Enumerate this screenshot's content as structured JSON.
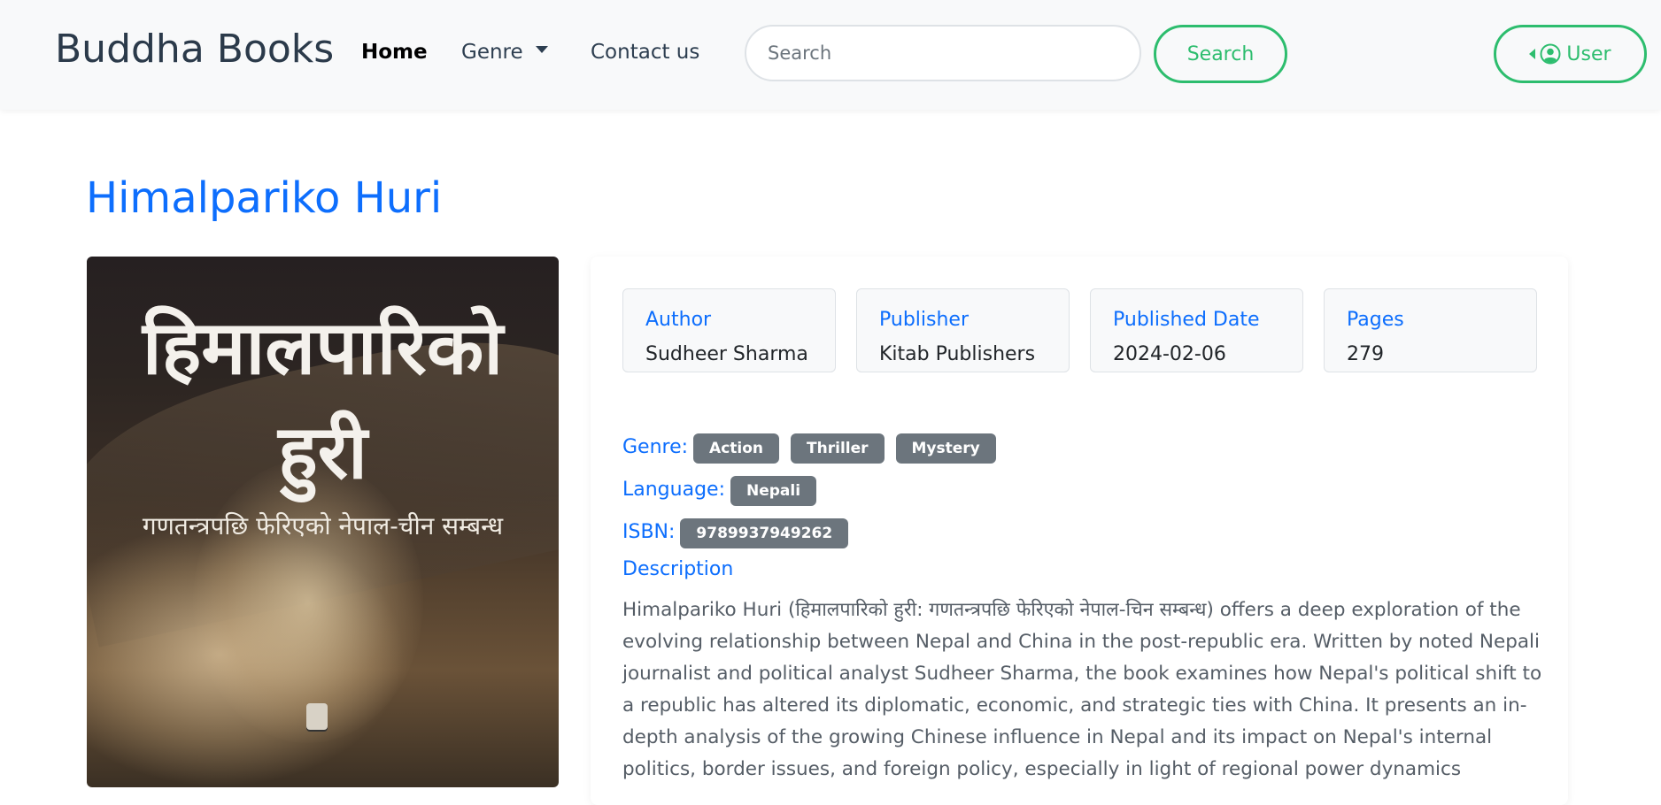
{
  "navbar": {
    "brand": "Buddha Books",
    "links": {
      "home": "Home",
      "genre": "Genre",
      "contact": "Contact us"
    },
    "search": {
      "placeholder": "Search",
      "value": "",
      "button_label": "Search"
    },
    "user_button_label": "User"
  },
  "book": {
    "title": "Himalpariko Huri",
    "cover": {
      "title_line1": "हिमालपारिको",
      "title_line2": "हुरी",
      "subtitle": "गणतन्त्रपछि फेरिएको नेपाल-चीन सम्बन्ध"
    },
    "meta": [
      {
        "label": "Author",
        "value": "Sudheer Sharma"
      },
      {
        "label": "Publisher",
        "value": "Kitab Publishers"
      },
      {
        "label": "Published Date",
        "value": "2024-02-06"
      },
      {
        "label": "Pages",
        "value": "279"
      }
    ],
    "genre_label": "Genre:",
    "genres": [
      "Action",
      "Thriller",
      "Mystery"
    ],
    "language_label": "Language:",
    "language": "Nepali",
    "isbn_label": "ISBN:",
    "isbn": "9789937949262",
    "description_label": "Description",
    "description": "Himalpariko Huri (हिमालपारिको हुरी: गणतन्त्रपछि फेरिएको नेपाल-चिन सम्बन्ध) offers a deep exploration of the evolving relationship between Nepal and China in the post-republic era. Written by noted Nepali journalist and political analyst Sudheer Sharma, the book examines how Nepal's political shift to a republic has altered its diplomatic, economic, and strategic ties with China. It presents an in-depth analysis of the growing Chinese influence in Nepal and its impact on Nepal's internal politics, border issues, and foreign policy, especially in light of regional power dynamics"
  },
  "colors": {
    "accent": "#0d6efd",
    "success": "#2dbd6e",
    "badge": "#6c757d",
    "navbar_bg": "#f8f9fa"
  },
  "icons": {
    "genre_dropdown": "caret-down-icon",
    "user": "user-circle-icon",
    "user_dropdown": "caret-left-icon"
  }
}
